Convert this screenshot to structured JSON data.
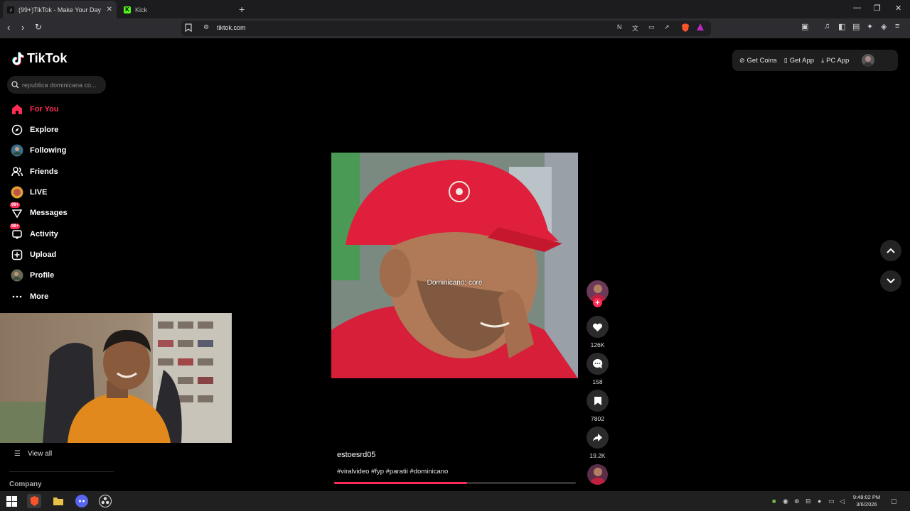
{
  "browser": {
    "tabs": [
      {
        "title": "(99+)TikTok - Make Your Day",
        "active": true
      },
      {
        "title": "Kick",
        "active": false
      }
    ],
    "new_tab": "+",
    "url": "tiktok.com",
    "window_controls": {
      "minimize": "—",
      "restore": "❐",
      "close": "✕"
    }
  },
  "app": {
    "logo_text": "TikTok",
    "search_placeholder": "republica dominicana co..."
  },
  "sidebar": {
    "items": [
      {
        "label": "For You",
        "icon": "home-icon",
        "active": true
      },
      {
        "label": "Explore",
        "icon": "compass-icon"
      },
      {
        "label": "Following",
        "icon": "following-avatar-icon"
      },
      {
        "label": "Friends",
        "icon": "friends-icon"
      },
      {
        "label": "LIVE",
        "icon": "live-icon"
      },
      {
        "label": "Messages",
        "icon": "messages-icon",
        "badge": "99+"
      },
      {
        "label": "Activity",
        "icon": "activity-icon",
        "badge": "99+"
      },
      {
        "label": "Upload",
        "icon": "upload-icon"
      },
      {
        "label": "Profile",
        "icon": "profile-avatar-icon"
      },
      {
        "label": "More",
        "icon": "more-icon"
      }
    ],
    "view_all": "View all",
    "company": "Company"
  },
  "header": {
    "get_coins": "Get Coins",
    "get_app": "Get App",
    "pc_app": "PC App"
  },
  "video": {
    "overlay_text": "Dominicano: core",
    "author": "estoesrd05",
    "tags": "#viralvideo #fyp #paratii #dominicano",
    "progress": 0.55,
    "likes": "126K",
    "comments": "158",
    "saves": "7802",
    "shares": "19.2K"
  },
  "taskbar": {
    "time": "9:48:02 PM",
    "date": "3/6/2026"
  },
  "colors": {
    "accent": "#fe2c55",
    "background": "#000000"
  }
}
